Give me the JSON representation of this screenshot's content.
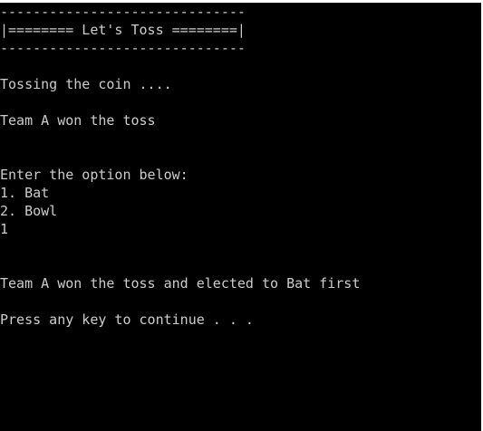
{
  "console": {
    "lines": [
      "------------------------------",
      "|======== Let's Toss ========|",
      "------------------------------",
      "",
      "Tossing the coin ....",
      "",
      "Team A won the toss",
      "",
      "",
      "Enter the option below:",
      "1. Bat",
      "2. Bowl",
      "1",
      "",
      "",
      "Team A won the toss and elected to Bat first",
      "",
      "Press any key to continue . . ."
    ]
  },
  "colors": {
    "background": "#000000",
    "text": "#cccccc"
  }
}
